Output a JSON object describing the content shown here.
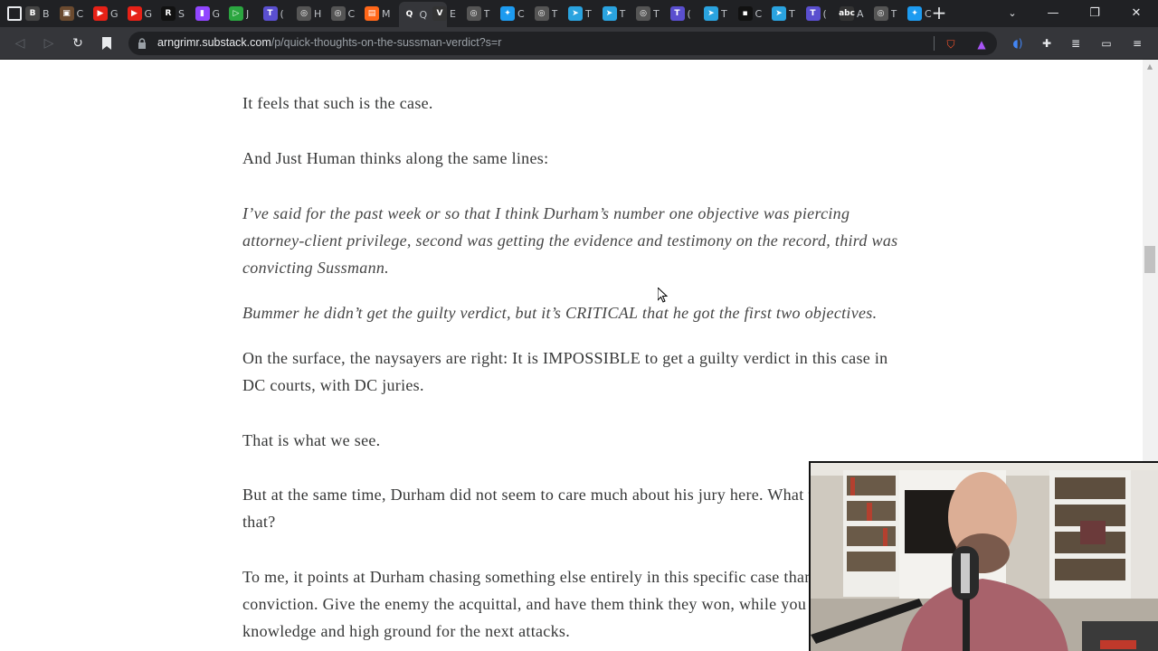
{
  "browser": {
    "tabs": [
      {
        "fav": "B",
        "color": "#444",
        "label": "B"
      },
      {
        "fav": "▣",
        "color": "#6b4a2f",
        "label": "C"
      },
      {
        "fav": "▶",
        "color": "#e62117",
        "label": "G"
      },
      {
        "fav": "▶",
        "color": "#e62117",
        "label": "G"
      },
      {
        "fav": "R",
        "color": "#111",
        "label": "S"
      },
      {
        "fav": "▮",
        "color": "#9146ff",
        "label": "G"
      },
      {
        "fav": "▷",
        "color": "#2ba640",
        "label": "J"
      },
      {
        "fav": "T",
        "color": "#5a4fcf",
        "label": "("
      },
      {
        "fav": "◎",
        "color": "#555",
        "label": "H"
      },
      {
        "fav": "◎",
        "color": "#555",
        "label": "C"
      },
      {
        "fav": "▤",
        "color": "#ff6719",
        "label": "M"
      },
      {
        "fav": "Q",
        "color": "#35363a",
        "label": "Q",
        "active": true
      },
      {
        "fav": "V",
        "color": "#333",
        "label": "E"
      },
      {
        "fav": "◎",
        "color": "#555",
        "label": "T"
      },
      {
        "fav": "✦",
        "color": "#1d9bf0",
        "label": "C"
      },
      {
        "fav": "◎",
        "color": "#555",
        "label": "T"
      },
      {
        "fav": "➤",
        "color": "#2aa3df",
        "label": "T"
      },
      {
        "fav": "➤",
        "color": "#2aa3df",
        "label": "T"
      },
      {
        "fav": "◎",
        "color": "#555",
        "label": "T"
      },
      {
        "fav": "T",
        "color": "#5a4fcf",
        "label": "("
      },
      {
        "fav": "➤",
        "color": "#2aa3df",
        "label": "T"
      },
      {
        "fav": "▪",
        "color": "#111",
        "label": "C"
      },
      {
        "fav": "➤",
        "color": "#2aa3df",
        "label": "T"
      },
      {
        "fav": "T",
        "color": "#5a4fcf",
        "label": "("
      },
      {
        "fav": "abc",
        "color": "#333",
        "label": "A"
      },
      {
        "fav": "◎",
        "color": "#555",
        "label": "T"
      },
      {
        "fav": "✦",
        "color": "#1d9bf0",
        "label": "C"
      }
    ],
    "url_host": "arngrimr.substack.com",
    "url_path": "/p/quick-thoughts-on-the-sussman-verdict?s=r"
  },
  "article": {
    "paragraphs": [
      {
        "text": "It feels that such is the case.",
        "italic": false
      },
      {
        "text": "And Just Human thinks along the same lines:",
        "italic": false
      },
      {
        "text": "I’ve said for the past week or so that I think Durham’s number one objective was piercing attorney-client privilege, second was getting the evidence and testimony on the record, third was convicting Sussmann.",
        "italic": true
      },
      {
        "text": "Bummer he didn’t get the guilty verdict, but it’s CRITICAL that he got the first two objectives.",
        "italic": true
      },
      {
        "text": "On the surface, the naysayers are right: It is IMPOSSIBLE to get a guilty verdict in this case in DC courts, with DC juries.",
        "italic": false
      },
      {
        "text": "That is what we see.",
        "italic": false
      },
      {
        "text": "But at the same time, Durham did not seem to care much about his jury here. What to make of that?",
        "italic": false
      },
      {
        "text": "To me, it points at Durham chasing something else entirely in this specific case than an actual conviction. Give the enemy the acquittal, and have them think they won, while you gained the knowledge and high ground for the next attacks.",
        "italic": false
      }
    ]
  },
  "colors": {
    "tab_strip": "#202124",
    "toolbar": "#35363a",
    "text": "#363737"
  }
}
